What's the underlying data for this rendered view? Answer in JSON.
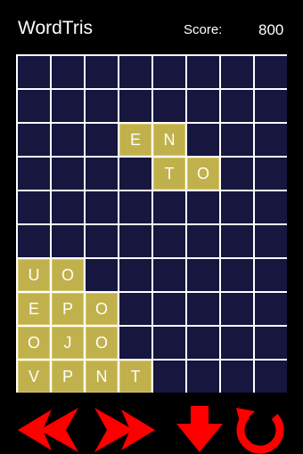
{
  "app": {
    "title": "WordTris",
    "score_label": "Score:",
    "score_value": "800"
  },
  "board": {
    "rows": 10,
    "cols": 8,
    "tiles": [
      {
        "row": 2,
        "col": 3,
        "letter": "E"
      },
      {
        "row": 2,
        "col": 4,
        "letter": "N"
      },
      {
        "row": 3,
        "col": 4,
        "letter": "T"
      },
      {
        "row": 3,
        "col": 5,
        "letter": "O"
      },
      {
        "row": 6,
        "col": 0,
        "letter": "U"
      },
      {
        "row": 6,
        "col": 1,
        "letter": "O"
      },
      {
        "row": 7,
        "col": 0,
        "letter": "E"
      },
      {
        "row": 7,
        "col": 1,
        "letter": "P"
      },
      {
        "row": 7,
        "col": 2,
        "letter": "O"
      },
      {
        "row": 8,
        "col": 0,
        "letter": "O"
      },
      {
        "row": 8,
        "col": 1,
        "letter": "J"
      },
      {
        "row": 8,
        "col": 2,
        "letter": "O"
      },
      {
        "row": 9,
        "col": 0,
        "letter": "V"
      },
      {
        "row": 9,
        "col": 1,
        "letter": "P"
      },
      {
        "row": 9,
        "col": 2,
        "letter": "N"
      },
      {
        "row": 9,
        "col": 3,
        "letter": "T"
      }
    ],
    "colors": {
      "empty": "#16163f",
      "tile": "#c1b14c",
      "grid": "#ffffff"
    }
  },
  "controls": {
    "color": "#ff0000",
    "buttons": [
      {
        "name": "move-left-button",
        "icon": "arrow-left-icon"
      },
      {
        "name": "move-right-button",
        "icon": "arrow-right-icon"
      },
      {
        "name": "drop-down-button",
        "icon": "arrow-down-icon"
      },
      {
        "name": "rotate-button",
        "icon": "rotate-icon"
      }
    ]
  }
}
